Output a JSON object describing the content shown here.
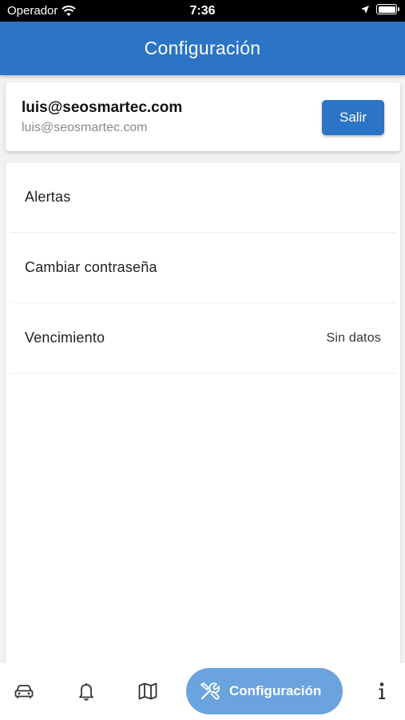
{
  "status_bar": {
    "carrier": "Operador",
    "time": "7:36"
  },
  "header": {
    "title": "Configuración"
  },
  "account": {
    "email": "luis@seosmartec.com",
    "subtitle": "luis@seosmartec.com",
    "logout_label": "Salir"
  },
  "settings": {
    "items": [
      {
        "label": "Alertas",
        "value": ""
      },
      {
        "label": "Cambiar contraseña",
        "value": ""
      },
      {
        "label": "Vencimiento",
        "value": "Sin datos"
      }
    ]
  },
  "bottom_nav": {
    "items": [
      {
        "icon": "car-icon"
      },
      {
        "icon": "bell-icon"
      },
      {
        "icon": "map-icon"
      },
      {
        "icon": "tools-icon",
        "label": "Configuración",
        "active": true
      },
      {
        "icon": "info-icon"
      }
    ],
    "active_color": "#6aa3de"
  },
  "colors": {
    "primary": "#2b74c6"
  }
}
